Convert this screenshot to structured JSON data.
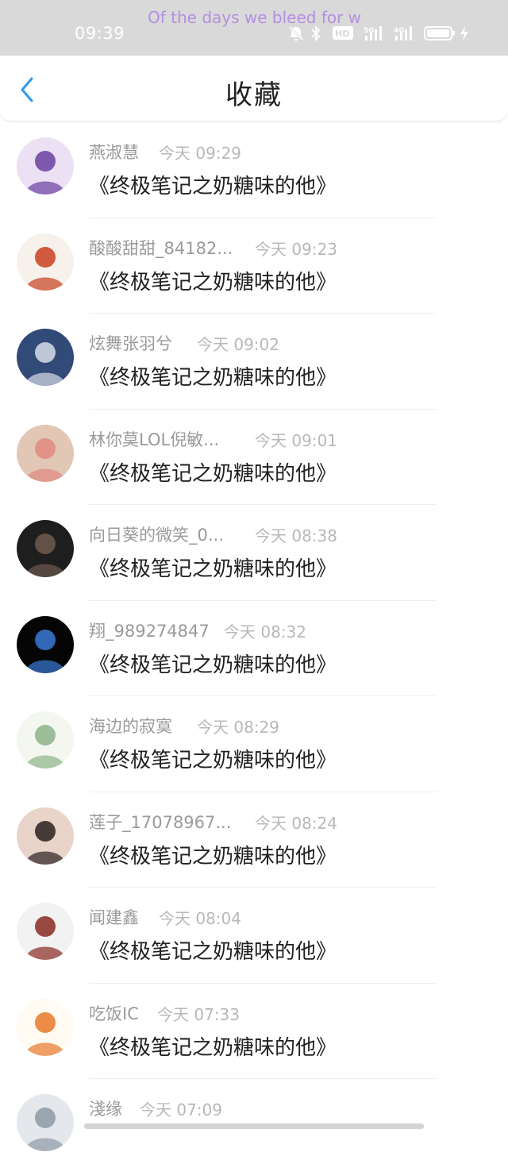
{
  "status_bar": {
    "time": "09:39",
    "marquee_text": "Of the days  we bleed for wh",
    "icons": [
      "mute-icon",
      "bluetooth-icon",
      "hd-icon",
      "signal-5g-icon",
      "signal-4g-icon",
      "battery-icon",
      "charging-icon"
    ],
    "hd_label": "HD",
    "net1": "5G",
    "net2": "4G"
  },
  "header": {
    "title": "收藏",
    "back_icon": "chevron-left-icon",
    "accent": "#2d9bf0"
  },
  "items": [
    {
      "username": "燕淑慧",
      "time": "今天 09:29",
      "title": "《终极笔记之奶糖味的他》",
      "avatar_colors": [
        "#ebe0f4",
        "#6a3fa0"
      ]
    },
    {
      "username": "酸酸甜甜_84182...",
      "time": "今天 09:23",
      "title": "《终极笔记之奶糖味的他》",
      "avatar_colors": [
        "#f6f1ea",
        "#c8401e"
      ]
    },
    {
      "username": "炫舞张羽兮",
      "time": "今天 09:02",
      "title": "《终极笔记之奶糖味的他》",
      "avatar_colors": [
        "#314a78",
        "#d8dce8"
      ]
    },
    {
      "username": "林你莫LOL倪敏...",
      "time": "今天 09:01",
      "title": "《终极笔记之奶糖味的他》",
      "avatar_colors": [
        "#e2c7b6",
        "#e08a80"
      ]
    },
    {
      "username": "向日葵的微笑_0...",
      "time": "今天 08:38",
      "title": "《终极笔记之奶糖味的他》",
      "avatar_colors": [
        "#1e1e1e",
        "#6e5a4e"
      ]
    },
    {
      "username": "翔_989274847",
      "time": "今天 08:32",
      "title": "《终极笔记之奶糖味的他》",
      "avatar_colors": [
        "#050505",
        "#3a7ad8"
      ]
    },
    {
      "username": "海边的寂寞",
      "time": "今天 08:29",
      "title": "《终极笔记之奶糖味的他》",
      "avatar_colors": [
        "#f4f7ef",
        "#8db38a"
      ]
    },
    {
      "username": "莲子_17078967...",
      "time": "今天 08:24",
      "title": "《终极笔记之奶糖味的他》",
      "avatar_colors": [
        "#e8d4c8",
        "#2a2020"
      ]
    },
    {
      "username": "闻建鑫",
      "time": "今天 08:04",
      "title": "《终极笔记之奶糖味的他》",
      "avatar_colors": [
        "#f2f2f2",
        "#8a2a22"
      ]
    },
    {
      "username": "吃饭IC",
      "time": "今天 07:33",
      "title": "《终极笔记之奶糖味的他》",
      "avatar_colors": [
        "#fffaf2",
        "#e8782a"
      ]
    },
    {
      "username": "淺缘",
      "time": "今天 07:09",
      "title": "",
      "avatar_colors": [
        "#e4e8ec",
        "#8d99a6"
      ]
    }
  ]
}
